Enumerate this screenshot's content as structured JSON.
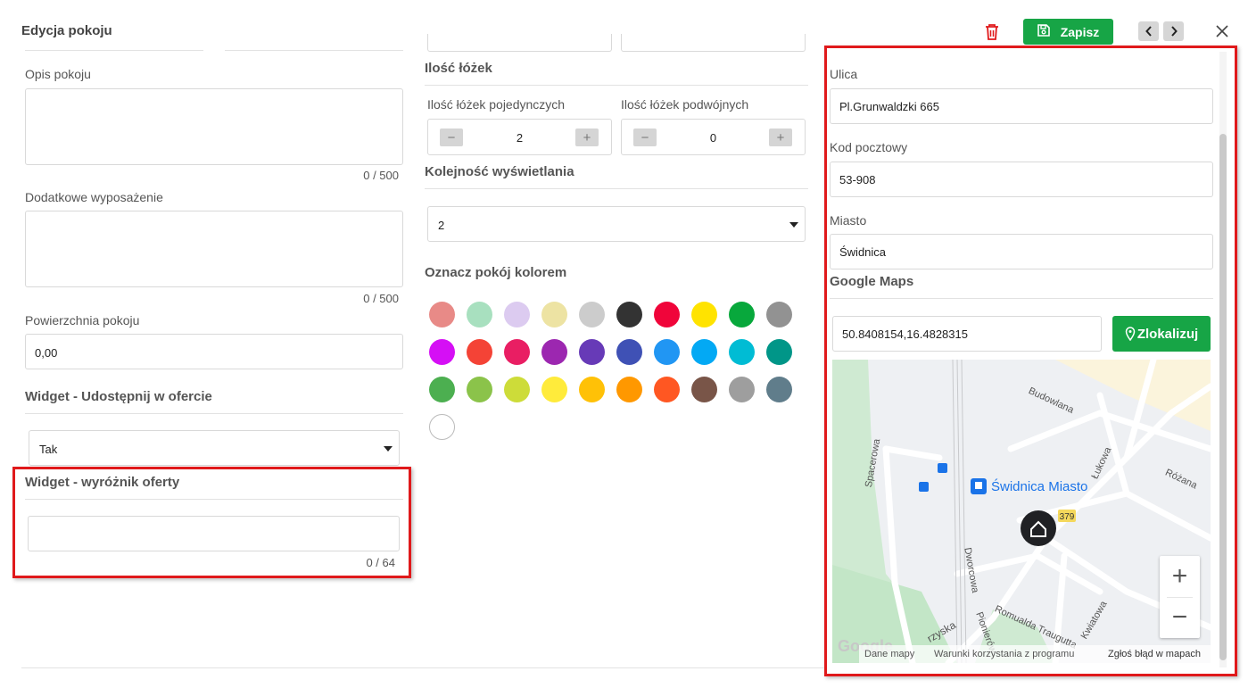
{
  "dialog": {
    "title": "Edycja pokoju"
  },
  "toolbar": {
    "save_label": "Zapisz"
  },
  "left": {
    "description_label": "Opis pokoju",
    "description_counter": "0 / 500",
    "equipment_label": "Dodatkowe wyposażenie",
    "equipment_counter": "0 / 500",
    "area_label": "Powierzchnia pokoju",
    "area_value": "0,00",
    "widget_share_heading": "Widget - Udostępnij w ofercie",
    "widget_share_value": "Tak",
    "widget_highlight_heading": "Widget - wyróżnik oferty",
    "widget_highlight_value": "",
    "widget_highlight_counter": "0 / 64"
  },
  "middle": {
    "beds_heading": "Ilość łóżek",
    "single_beds_label": "Ilość łóżek pojedynczych",
    "single_beds_value": "2",
    "double_beds_label": "Ilość łóżek podwójnych",
    "double_beds_value": "0",
    "order_heading": "Kolejność wyświetlania",
    "order_value": "2",
    "color_heading": "Oznacz pokój kolorem",
    "colors": [
      "#e88a87",
      "#a8e0bf",
      "#dccbf0",
      "#ede3a3",
      "#cccccc",
      "#333333",
      "#f0053a",
      "#ffe300",
      "#08a83c",
      "#929292",
      "#d50ff5",
      "#f44336",
      "#e91e63",
      "#9c27b0",
      "#673ab7",
      "#3f51b5",
      "#2196f3",
      "#03a9f4",
      "#00bcd4",
      "#009688",
      "#4caf50",
      "#8bc34a",
      "#cddc39",
      "#ffeb3b",
      "#ffc107",
      "#ff9800",
      "#ff5722",
      "#795548",
      "#9e9e9e",
      "#607d8b",
      "#ffffff"
    ]
  },
  "right": {
    "street_label": "Ulica",
    "street_value": "Pl.Grunwaldzki 665",
    "postal_label": "Kod pocztowy",
    "postal_value": "53-908",
    "city_label": "Miasto",
    "city_value": "Świdnica",
    "maps_heading": "Google Maps",
    "coords_value": "50.8408154,16.4828315",
    "locate_label": "Zlokalizuj"
  },
  "map": {
    "station_label": "Świdnica Miasto",
    "streets": [
      "Budowlana",
      "Różana",
      "Łukowa",
      "Spacerowa",
      "Dworcowa",
      "Romualda Traugutta",
      "Kwiatowa",
      "Pionierów",
      "rzyska"
    ],
    "road_number": "379",
    "zoom_in": "+",
    "zoom_out": "−",
    "logo": "Google",
    "footer_data": "Dane mapy",
    "footer_terms": "Warunki korzystania z programu",
    "footer_report": "Zgłoś błąd w mapach"
  }
}
